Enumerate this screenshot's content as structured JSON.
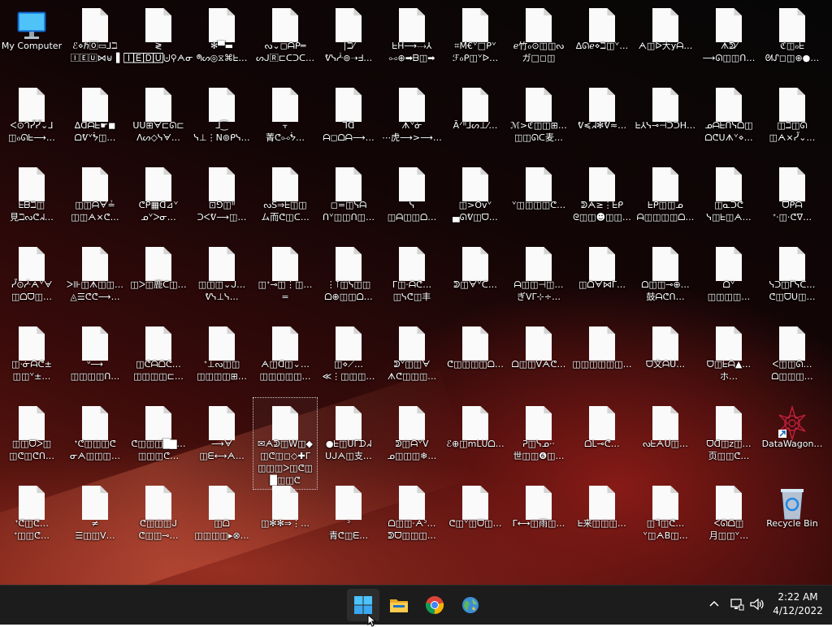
{
  "desktop": {
    "icons": [
      {
        "type": "computer",
        "label": [
          "My Computer"
        ]
      },
      {
        "type": "file",
        "label": [
          "ℰ⋄ℏ🄾▭⅃ℶ",
          "🄸🄴🅄⋈⊌▐"
        ]
      },
      {
        "type": "file",
        "label": [
          "≷",
          "🄸🄴🄳🅄⨄⚲ᗅᓂ"
        ]
      },
      {
        "type": "file",
        "label": [
          "✻▀▬",
          "ᖗᔕ◎⧖⌘ᖶ…"
        ]
      },
      {
        "type": "file",
        "label": [
          "ᔓ⌄◻ᗩᑭ═",
          "ᔕᒍ🅁⊏ᑕᑐᑕ…"
        ]
      },
      {
        "type": "file",
        "label": [
          "∣ℶ⁄",
          "ᕓᓭᓿ⊚➝ᖵ…"
        ]
      },
      {
        "type": "file",
        "label": [
          "ᖶH⟶⤏⅄",
          "⧟⊕➡ᗷ◫➡"
        ]
      },
      {
        "type": "file",
        "label": [
          "⌗M€ᘁ□ᑭᘁ",
          "ℱℴᑭ◫ᘁᐅ…"
        ]
      },
      {
        "type": "file",
        "label": [
          "ℯ竹ℴ⊙◫◫ᔓ",
          "ガ□◻◫"
        ]
      },
      {
        "type": "file",
        "label": [
          "∆ᘏℯ⋄ℶ◫ᘁ…"
        ]
      },
      {
        "type": "file",
        "label": [
          "ᗅ◫ᐅ大yᗩ…"
        ]
      },
      {
        "type": "file",
        "label": [
          "ᗑᕲ⁄",
          "⟶ᘏ◫◫ᑎ…"
        ]
      },
      {
        "type": "file",
        "label": [
          "ℭ◫ℴᖶ",
          "ᘛᔑ◻◫⊕●…"
        ]
      },
      {
        "type": "file",
        "label": [
          "ᐸ⊙ᒉᓮᓮ⌄⅃",
          "◫ℴᘏᖶ⟶…"
        ]
      },
      {
        "type": "file",
        "label": [
          "∆ᗡᗩᖶ☛◼",
          "ᗝᕓᘁᖭ◫…"
        ]
      },
      {
        "type": "file",
        "label": [
          "ᑌᑌ⊞ᗄ⊏ᘏ⊏",
          "ᐱᔕ◇ᓭᗄ…"
        ]
      },
      {
        "type": "file",
        "label": [
          "⅃⁐",
          "ᓭ⊥⋮N⊚ᑭᓭ…"
        ]
      },
      {
        "type": "file",
        "label": [
          "⫟",
          "菁ᕦ⧟ᖭ…"
        ]
      },
      {
        "type": "file",
        "label": [
          "⅂ᗡ",
          "ᗩ◻ᗝᗩ⟶…"
        ]
      },
      {
        "type": "file",
        "label": [
          "ᗑᘁᓃ",
          "⋯虎⟶>⟶…"
        ]
      },
      {
        "type": "file",
        "label": [
          "Ãᐟᐦ⅃ᔕ⊥⁄…"
        ]
      },
      {
        "type": "file",
        "label": [
          "ℳ>ℭ◫◫⊞…",
          "◫◫ᘏᑕ麦…"
        ]
      },
      {
        "type": "file",
        "label": [
          "ᕓ≼ᖽ✻ᕓ≈…"
        ]
      },
      {
        "type": "file",
        "label": [
          "ᖶ⅄ᓭ⊸⊣ᑐᑐH…"
        ]
      },
      {
        "type": "file",
        "label": [
          "ᓄᗩᖶᑎᓭᗝ◫",
          "ᗝᕦᑌᗑᘁ⋄…"
        ]
      },
      {
        "type": "file",
        "label": [
          "◫ℶ◫ᘏ",
          "◫ᗅ⨯ᓮ⌄…"
        ]
      },
      {
        "type": "file",
        "label": [
          "ᖶᗷℶ◫",
          "見ℶᔓᕦᖽ…"
        ]
      },
      {
        "type": "file",
        "label": [
          "◫◫ᗩᗄ≟",
          "◫◫ᗅ⨯ᕦ…"
        ]
      },
      {
        "type": "file",
        "label": [
          "ᕦᑭ▦ᗡ⊿ᘁ",
          "ᓄᘁᐳᓂ…"
        ]
      },
      {
        "type": "file",
        "label": [
          "⊡⅁◫ᐦ",
          "ᑐᐸᕓ⟶◫…"
        ]
      },
      {
        "type": "file",
        "label": [
          "ᔓS⇒ᖶ◫◫",
          "ム而ᕦ◫ᑕ…"
        ]
      },
      {
        "type": "file",
        "label": [
          "◻=◫ᓭᗩ",
          "ᑎᘁ◫◫ᑎ◫…"
        ]
      },
      {
        "type": "file",
        "label": [
          "ᓭ",
          "◫ᗩ◫◫ᗝ…"
        ]
      },
      {
        "type": "file",
        "label": [
          "◫>Ovᘁ",
          "▄ᘏᕓ◫ᗜ…"
        ]
      },
      {
        "type": "file",
        "label": [
          "ᘁ◫◫◫◫ᕦ…"
        ]
      },
      {
        "type": "file",
        "label": [
          "ᕲᗅ≥⋮ᖶᑭ",
          "ᘓ◫◫☻◫◫…"
        ]
      },
      {
        "type": "file",
        "label": [
          "ᖶᑭ◫◫ᓄ",
          "ᗩ◫◫◫◫ᗝ…"
        ]
      },
      {
        "type": "file",
        "label": [
          "◫ᓇᑐᕦ",
          "ᓭ◫ᖶ◫ᗅ…"
        ]
      },
      {
        "type": "file",
        "label": [
          "ᗜᑭᗩ",
          "ᕀ⋅◫⋅ᕦᐁ…"
        ]
      },
      {
        "type": "file",
        "label": [
          "ᓮ⊙ᓿᗅᘁᗄ",
          "◫ᗝᗜ◫…"
        ]
      },
      {
        "type": "file",
        "label": [
          "ᐳ⊪◫ᗑ◫◫…",
          "◬☰ᕦᕦ⟶…"
        ]
      },
      {
        "type": "file",
        "label": [
          "◫ᐳ◫鹿ᑕ◫…"
        ]
      },
      {
        "type": "file",
        "label": [
          "◫◫◫⌄ᒍ…",
          "ᕓᓭ⊥ᓭ…"
        ]
      },
      {
        "type": "file",
        "label": [
          "◫ᐩ⊸◫⋮◫…",
          "="
        ]
      },
      {
        "type": "file",
        "label": [
          "⋮⊺◫ᓭ◫◫",
          "ᗝ⊕◫◫ᗝ…"
        ]
      },
      {
        "type": "file",
        "label": [
          "ᒥ◫⋅ᗩᕦ…",
          "◫ᓭᕦ◫丰"
        ]
      },
      {
        "type": "file",
        "label": [
          "ᕲ◫ᗄᘁᑕ…"
        ]
      },
      {
        "type": "file",
        "label": [
          "ᗩ◫◫⊣◫…",
          "ぎᐯᒥ⊹÷…"
        ]
      },
      {
        "type": "file",
        "label": [
          "◫ᗝᗄ⋈ᒥ…"
        ]
      },
      {
        "type": "file",
        "label": [
          "ᗝ◫◫⊸⊕…",
          "鼓ᗩᕦᑎ…"
        ]
      },
      {
        "type": "file",
        "label": [
          "ᗝᘁ",
          "◫◫◫◫…"
        ]
      },
      {
        "type": "file",
        "label": [
          "ᓭᑐ◫ᒥᓭᑕ…",
          "ᕦ◫ᗜᑌ◫…"
        ]
      },
      {
        "type": "file",
        "label": [
          "◫⋅ᓃᗩᕦ±",
          "◫◫ᘁ±…"
        ]
      },
      {
        "type": "file",
        "label": [
          "ᐡ⟶",
          "◫◫◫◫ᑎ…"
        ]
      },
      {
        "type": "file",
        "label": [
          "◫ᕦᗩᗝᕦ…",
          "◫◫◫◫⊏…"
        ]
      },
      {
        "type": "file",
        "label": [
          "ᐩ⊥ᔓ◫◫",
          "◫◫◫◫⊞…"
        ]
      },
      {
        "type": "file",
        "label": [
          "ᗅ◫ᗡ◫⌄…",
          "◫◫◫◫◫…"
        ]
      },
      {
        "type": "file",
        "label": [
          "◫⋄⟋…",
          "≪⋮◫◫◫…"
        ]
      },
      {
        "type": "file",
        "label": [
          "ᕲᘁ◫◫ᗄ",
          "ᗑᕦ◫◫◫…"
        ]
      },
      {
        "type": "file",
        "label": [
          "ᕦ◫◫◫◫ᗝ…"
        ]
      },
      {
        "type": "file",
        "label": [
          "ᗝ◫◫ᐯᗅᕦ…"
        ]
      },
      {
        "type": "file",
        "label": [
          "◫◫◫◫◫◫…"
        ]
      },
      {
        "type": "file",
        "label": [
          "ᗜ文ᗩᑌ…"
        ]
      },
      {
        "type": "file",
        "label": [
          "ᗜ◫ᖶᗩ▲…",
          "ホ…"
        ]
      },
      {
        "type": "file",
        "label": [
          "ᐸ◫◫ᘏ…",
          "ᗝ◫◫◫…"
        ]
      },
      {
        "type": "file",
        "label": [
          "◫◫ᗜᐳ◫",
          "◫ᕦ◫ᕦᑎ…"
        ]
      },
      {
        "type": "file",
        "label": [
          "ᐩᕦ◫◫◫ᕦ",
          "ᓂᗅ◫◫◫…"
        ]
      },
      {
        "type": "file",
        "label": [
          "ᕦ◫◫◫█▇…",
          "◫◫◫ᕦ…"
        ]
      },
      {
        "type": "file",
        "label": [
          "⟶ᗄ",
          "◫ᗴ⟷ᗅ…"
        ]
      },
      {
        "type": "file",
        "label": [
          "✉ᗅᕲ◫W◫◆",
          "◫ᕦ◫◻◇✚ᒥ",
          "◫◫◫ᐳ◫ᕦ◫",
          "█◫◫ᕦ"
        ],
        "selected": true
      },
      {
        "type": "file",
        "label": [
          "●ᖶ◫ᑌᒥᗪᖽ",
          "ᑌᒍᗅ◫支…"
        ]
      },
      {
        "type": "file",
        "label": [
          "ᕲ◫ᗩᘁᐯ",
          "ᓄ◫◫◫❄…"
        ]
      },
      {
        "type": "file",
        "label": [
          "ℰ⊕◫mᒪᑌᗝ…"
        ]
      },
      {
        "type": "file",
        "label": [
          "ᕈ◫ᓭᓄ⋅⋅",
          "世◫◫❻◫…"
        ]
      },
      {
        "type": "file",
        "label": [
          "ᗝᒪ⊸ᕦ…"
        ]
      },
      {
        "type": "file",
        "label": [
          "ᔓᖶᗅᑌ◫…"
        ]
      },
      {
        "type": "file",
        "label": [
          "ᗜᗡ◫z◫…",
          "页◫◫ᕦ…"
        ]
      },
      {
        "type": "datawagon",
        "label": [
          "DataWagon…"
        ]
      },
      {
        "type": "file",
        "label": [
          "ᐩᕦ◫ᕦ…",
          "ᐩ◫◫ᕦ…"
        ]
      },
      {
        "type": "file",
        "label": [
          "≠",
          "☰◫◫ᐯ…"
        ]
      },
      {
        "type": "file",
        "label": [
          "ᕦ◫◫◫ᒍ",
          "ᕦ◫◫⊸…"
        ]
      },
      {
        "type": "file",
        "label": [
          "◫ᗝ",
          "◫◫◫◫▸⊗…"
        ]
      },
      {
        "type": "file",
        "label": [
          "◫✻✻⇒⋮…"
        ]
      },
      {
        "type": "file",
        "label": [
          "ᐣ",
          "青ᕦ◫ᗴ…"
        ]
      },
      {
        "type": "file",
        "label": [
          "ᗝ◫◫⋅ᗅᐣ…",
          "ᕲᗜ◫◫◫…"
        ]
      },
      {
        "type": "file",
        "label": [
          "ᕦ◫ᘁ◫ᗜ◫…"
        ]
      },
      {
        "type": "file",
        "label": [
          "ᒥ⟷◫雨◫…"
        ]
      },
      {
        "type": "file",
        "label": [
          "ᖶ来◫◫◫…"
        ]
      },
      {
        "type": "file",
        "label": [
          "◫ᒣ◫ᕦ…",
          "ᘁ◫ᗅB◫…"
        ]
      },
      {
        "type": "file",
        "label": [
          "ᐸᘏᗝ◫",
          "月◫◫ᘁ…"
        ]
      },
      {
        "type": "recycle",
        "label": [
          "Recycle Bin"
        ]
      }
    ]
  },
  "taskbar": {
    "start_icon": "windows-logo",
    "pinned": [
      {
        "name": "file-explorer",
        "label": ""
      },
      {
        "name": "chrome",
        "label": ""
      },
      {
        "name": "globe-app",
        "label": ""
      }
    ],
    "tray": {
      "chevron": "chevron-up",
      "network": "network-icon",
      "volume": "speaker-icon"
    },
    "time": "2:22 AM",
    "date": "4/12/2022"
  }
}
